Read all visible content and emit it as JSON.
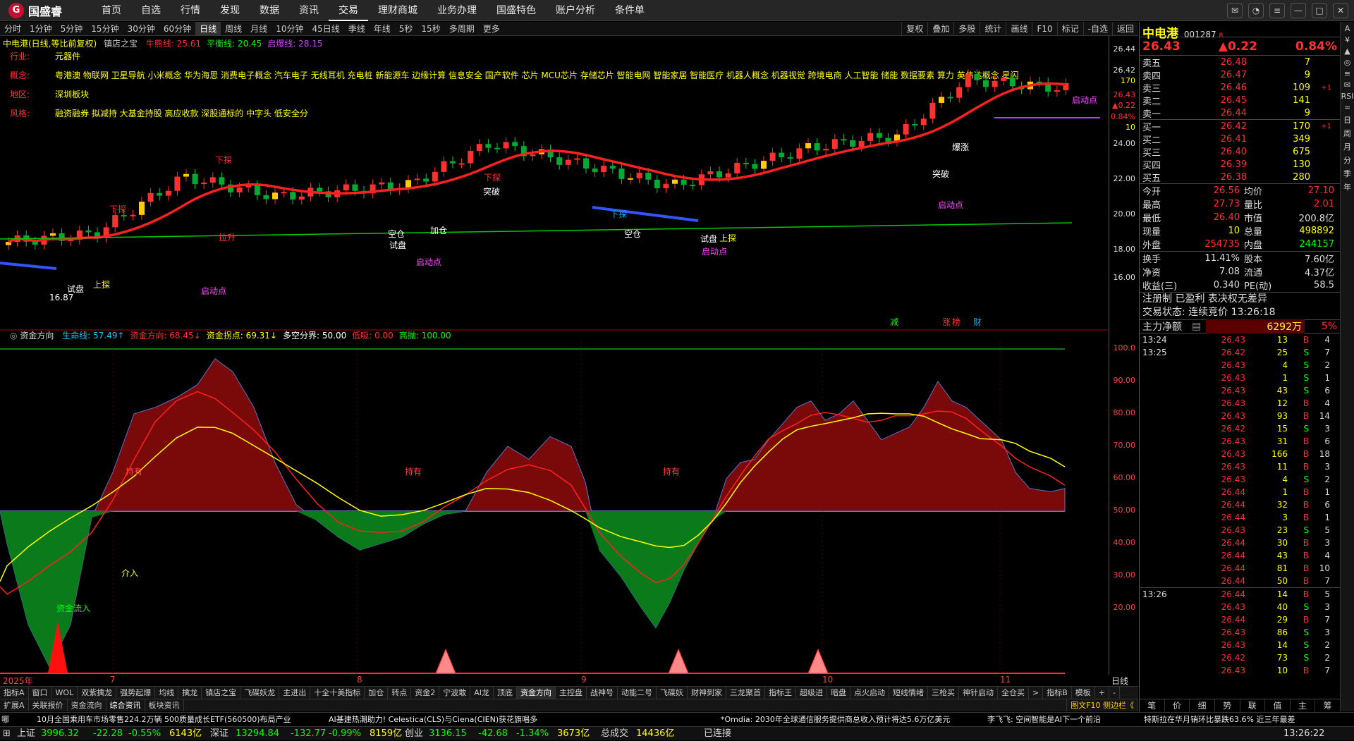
{
  "nav": {
    "brand": "国盛睿",
    "items": [
      "首页",
      "自选",
      "行情",
      "发现",
      "数据",
      "资讯",
      "交易",
      "理财商城",
      "业务办理",
      "国盛特色",
      "账户分析",
      "条件单"
    ],
    "active": "交易"
  },
  "periods": [
    "分时",
    "1分钟",
    "5分钟",
    "15分钟",
    "30分钟",
    "60分钟",
    "日线",
    "周线",
    "月线",
    "10分钟",
    "45日线",
    "季线",
    "年线",
    "5秒",
    "15秒",
    "多周期",
    "更多"
  ],
  "period_active": "日线",
  "chart_tools": [
    "复权",
    "叠加",
    "多股",
    "统计",
    "画线",
    "F10",
    "标记",
    "-自选",
    "返回"
  ],
  "chart_info": {
    "title": "中电港(日线,等比前复权)",
    "indicator": "镇店之宝",
    "lines": [
      {
        "label": "牛熊线: 25.61",
        "color": "#ff3030"
      },
      {
        "label": "平衡线: 20.45",
        "color": "#00ff00"
      },
      {
        "label": "启爆线: 28.15",
        "color": "#cc44ff"
      }
    ]
  },
  "tags": [
    {
      "key": "行业:",
      "value": "元器件"
    },
    {
      "key": "概念:",
      "value": "粤港澳 物联网 卫星导航 小米概念 华为海思 消费电子概念 汽车电子 无线耳机 充电桩 新能源车 边缘计算 信息安全 国产软件 芯片 MCU芯片 存储芯片 智能电网 智能家居 智能医疗 机器人概念 机器视觉 跨境电商 人工智能 储能 数据要素 算力 英伟达概念 星闪"
    },
    {
      "key": "地区:",
      "value": "深圳板块"
    },
    {
      "key": "风格:",
      "value": "融资融券 拟减持 大基金持股 高应收款 深股通标的 中字头 低安全分"
    }
  ],
  "price_axis": [
    "26.44",
    "26.42",
    "170",
    "26.43",
    "▲0.22",
    "0.84%",
    "10",
    "24.00",
    "22.00",
    "20.00",
    "18.00",
    "16.00"
  ],
  "signals": {
    "buy": "下探",
    "pullup": "拉升",
    "trial": "试盘",
    "start": "启动点",
    "up": "上探",
    "down": "下探",
    "breakout": "突破",
    "empty": "空仓",
    "surge": "爆涨",
    "add": "加仓",
    "lowpoint": "16.87"
  },
  "bottom_marks": [
    {
      "text": "减",
      "color": "#00ff00"
    },
    {
      "text": "涨",
      "color": "#ff3030"
    },
    {
      "text": "榜",
      "color": "#ff3030"
    },
    {
      "text": "财",
      "color": "#00aaff"
    }
  ],
  "indicator_panel": {
    "name": "资金方向",
    "lines": [
      {
        "label": "生命线: 57.49↑",
        "color": "#00ccff"
      },
      {
        "label": "资金方向: 68.45↓",
        "color": "#ff3030"
      },
      {
        "label": "资金拐点: 69.31↓",
        "color": "#ffff00"
      },
      {
        "label": "多空分界: 50.00",
        "color": "#ffffff"
      },
      {
        "label": "低吸: 0.00",
        "color": "#ff3030"
      },
      {
        "label": "高抛: 100.00",
        "color": "#00ff00"
      }
    ],
    "axis": [
      "100.0",
      "90.00",
      "80.00",
      "70.00",
      "60.00",
      "50.00",
      "40.00",
      "30.00",
      "20.00"
    ],
    "annotations": {
      "hold": "持有",
      "intervene": "介入",
      "inflow": "资金流入"
    }
  },
  "dates": {
    "year": "2025年",
    "months": [
      "7",
      "8",
      "9",
      "10",
      "11"
    ],
    "axis_label": "日线"
  },
  "tabs_row1": [
    "指标A",
    "窗口",
    "WOL",
    "双紫擒龙",
    "强势起爆",
    "均线",
    "擒龙",
    "镇店之宝",
    "飞碟妖龙",
    "主进出",
    "十全十美指标",
    "加仓",
    "转点",
    "资金2",
    "宁波敢",
    "AI龙",
    "顶底",
    "资金方向",
    "主控盘",
    "战神号",
    "动能二号",
    "飞碟妖",
    "财神到家",
    "三龙聚首",
    "指标王",
    "超级进",
    "暗盘",
    "点火启动",
    "短线情绪",
    "三枪买",
    "神针启动",
    "全仓买",
    ">",
    "指标B",
    "模板",
    "+",
    "-"
  ],
  "tabs_row1_active": "资金方向",
  "tabs_row2": [
    "扩展A",
    "关联报价",
    "资金流向",
    "综合资讯",
    "板块资讯"
  ],
  "tabs_row2_right": "图文F10 侧边栏《",
  "ticker": [
    "哪",
    "10月全国乘用车市场零售224.2万辆 500质量成长ETF(560500)布局产业",
    "AI基建热潮助力! Celestica(CLS)与Ciena(CIEN)获花旗唱多",
    "*Omdia: 2030年全球通信服务提供商总收入预计将达5.6万亿美元",
    "李飞飞: 空间智能是AI下一个前沿",
    "特斯拉在华月销环比暴跌63.6% 近三年最差"
  ],
  "status": {
    "sh": {
      "name": "上证",
      "val": "3996.32",
      "chg": "-22.28",
      "pct": "-0.55%",
      "amt": "6143亿"
    },
    "sz": {
      "name": "深证",
      "val": "13294.84",
      "chg": "-132.77",
      "pct": "-0.99%",
      "amt": "8159亿"
    },
    "cy": {
      "name": "创业",
      "val": "3136.15",
      "chg": "-42.68",
      "pct": "-1.34%",
      "amt": "3673亿"
    },
    "total": {
      "name": "总成交",
      "amt": "14436亿"
    },
    "conn": "已连接",
    "time": "13:26:22"
  },
  "quote": {
    "name": "中电港",
    "code": "001287",
    "badge": "R",
    "price": "26.43",
    "change": "▲0.22",
    "pct": "0.84%",
    "asks": [
      {
        "lbl": "卖五",
        "p": "26.48",
        "v": "7",
        "c": ""
      },
      {
        "lbl": "卖四",
        "p": "26.47",
        "v": "9",
        "c": ""
      },
      {
        "lbl": "卖三",
        "p": "26.46",
        "v": "109",
        "c": "+1"
      },
      {
        "lbl": "卖二",
        "p": "26.45",
        "v": "141",
        "c": ""
      },
      {
        "lbl": "卖一",
        "p": "26.44",
        "v": "9",
        "c": ""
      }
    ],
    "bids": [
      {
        "lbl": "买一",
        "p": "26.42",
        "v": "170",
        "c": "+1"
      },
      {
        "lbl": "买二",
        "p": "26.41",
        "v": "349",
        "c": ""
      },
      {
        "lbl": "买三",
        "p": "26.40",
        "v": "675",
        "c": ""
      },
      {
        "lbl": "买四",
        "p": "26.39",
        "v": "130",
        "c": ""
      },
      {
        "lbl": "买五",
        "p": "26.38",
        "v": "280",
        "c": ""
      }
    ],
    "stats": [
      {
        "k": "今开",
        "v": "26.56",
        "vc": "#ff3030",
        "k2": "均价",
        "v2": "27.10",
        "v2c": "#ff3030"
      },
      {
        "k": "最高",
        "v": "27.73",
        "vc": "#ff3030",
        "k2": "量比",
        "v2": "2.01",
        "v2c": "#ff3030"
      },
      {
        "k": "最低",
        "v": "26.40",
        "vc": "#ff3030",
        "k2": "市值",
        "v2": "200.8亿",
        "v2c": "#ddd"
      },
      {
        "k": "现量",
        "v": "10",
        "vc": "#ffff00",
        "k2": "总量",
        "v2": "498892",
        "v2c": "#ffff00"
      },
      {
        "k": "外盘",
        "v": "254735",
        "vc": "#ff3030",
        "k2": "内盘",
        "v2": "244157",
        "v2c": "#00ff00"
      }
    ],
    "stats2": [
      {
        "k": "换手",
        "v": "11.41%",
        "vc": "#ddd",
        "k2": "股本",
        "v2": "7.60亿",
        "v2c": "#ddd"
      },
      {
        "k": "净资",
        "v": "7.08",
        "vc": "#ddd",
        "k2": "流通",
        "v2": "4.37亿",
        "v2c": "#ddd"
      },
      {
        "k": "收益(三)",
        "v": "0.340",
        "vc": "#ddd",
        "k2": "PE(动)",
        "v2": "58.5",
        "v2c": "#ddd"
      }
    ],
    "notes": [
      "注册制 已盈利 表决权无差异",
      "交易状态: 连续竞价 13:26:18"
    ],
    "cash": {
      "label": "主力净额",
      "val": "6292万",
      "pct": "5%"
    },
    "ticks_a": [
      {
        "t": "13:24",
        "p": "26.43",
        "v": "13",
        "d": "B",
        "n": "4"
      },
      {
        "t": "13:25",
        "p": "26.42",
        "v": "25",
        "d": "S",
        "n": "7"
      },
      {
        "t": "",
        "p": "26.43",
        "v": "4",
        "d": "S",
        "n": "2"
      },
      {
        "t": "",
        "p": "26.43",
        "v": "1",
        "d": "S",
        "n": "1"
      },
      {
        "t": "",
        "p": "26.43",
        "v": "43",
        "d": "S",
        "n": "6"
      },
      {
        "t": "",
        "p": "26.43",
        "v": "12",
        "d": "B",
        "n": "4"
      },
      {
        "t": "",
        "p": "26.43",
        "v": "93",
        "d": "B",
        "n": "14"
      },
      {
        "t": "",
        "p": "26.42",
        "v": "15",
        "d": "S",
        "n": "3"
      },
      {
        "t": "",
        "p": "26.43",
        "v": "31",
        "d": "B",
        "n": "6"
      },
      {
        "t": "",
        "p": "26.43",
        "v": "166",
        "d": "B",
        "n": "18"
      },
      {
        "t": "",
        "p": "26.43",
        "v": "11",
        "d": "B",
        "n": "3"
      },
      {
        "t": "",
        "p": "26.43",
        "v": "4",
        "d": "S",
        "n": "2"
      },
      {
        "t": "",
        "p": "26.44",
        "v": "1",
        "d": "B",
        "n": "1"
      },
      {
        "t": "",
        "p": "26.44",
        "v": "32",
        "d": "B",
        "n": "6"
      },
      {
        "t": "",
        "p": "26.44",
        "v": "3",
        "d": "B",
        "n": "1"
      },
      {
        "t": "",
        "p": "26.43",
        "v": "23",
        "d": "S",
        "n": "5"
      },
      {
        "t": "",
        "p": "26.44",
        "v": "30",
        "d": "B",
        "n": "3"
      },
      {
        "t": "",
        "p": "26.44",
        "v": "43",
        "d": "B",
        "n": "4"
      },
      {
        "t": "",
        "p": "26.44",
        "v": "81",
        "d": "B",
        "n": "10"
      },
      {
        "t": "",
        "p": "26.44",
        "v": "50",
        "d": "B",
        "n": "7"
      }
    ],
    "ticks_b": [
      {
        "t": "13:26",
        "p": "26.44",
        "v": "14",
        "d": "B",
        "n": "5"
      },
      {
        "t": "",
        "p": "26.43",
        "v": "40",
        "d": "S",
        "n": "3"
      },
      {
        "t": "",
        "p": "26.44",
        "v": "29",
        "d": "B",
        "n": "7"
      },
      {
        "t": "",
        "p": "26.43",
        "v": "86",
        "d": "S",
        "n": "3"
      },
      {
        "t": "",
        "p": "26.43",
        "v": "14",
        "d": "S",
        "n": "2"
      },
      {
        "t": "",
        "p": "26.42",
        "v": "73",
        "d": "S",
        "n": "2"
      },
      {
        "t": "",
        "p": "26.43",
        "v": "10",
        "d": "B",
        "n": "7"
      }
    ],
    "bottom_tabs": [
      "笔",
      "价",
      "细",
      "势",
      "联",
      "值",
      "主",
      "筹"
    ]
  },
  "sidebar": [
    "A",
    "¥",
    "▲",
    "◎",
    "≡",
    "✉",
    "RSI",
    "≈",
    "日",
    "周",
    "月",
    "分",
    "季",
    "年"
  ],
  "colors": {
    "up": "#ff3030",
    "down": "#00ff00",
    "yellow": "#ffff00",
    "brand": "#c8102e"
  }
}
